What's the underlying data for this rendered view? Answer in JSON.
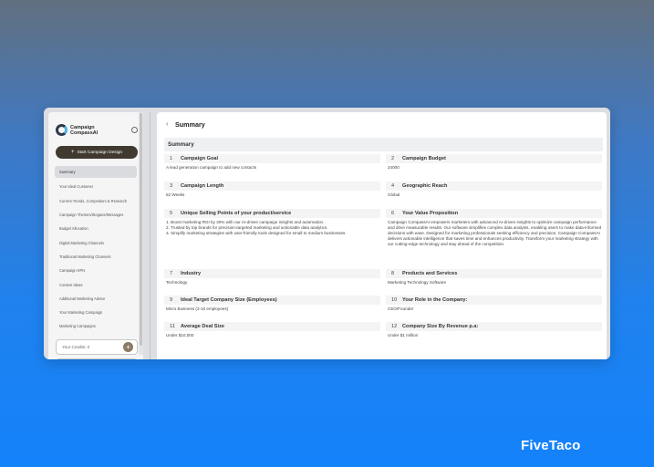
{
  "app": {
    "logo_line1": "Campaign",
    "logo_line2": "CompassAI",
    "start_button": "Start Campaign Design",
    "start_plus": "+",
    "credits_label": "Your Credits: 0",
    "credits_plus": "+"
  },
  "sidebar": {
    "items": [
      "Summary",
      "Your Ideal Customer",
      "Current Trends, Competitors & Research",
      "Campaign Themes/Slogans/Messages",
      "Budget Allocation",
      "Digital Marketing Channels",
      "Traditional Marketing Channels",
      "Campaign KPIs",
      "Content Ideas",
      "Additional Marketing Advice",
      "Your Marketing Campaign",
      "Marketing Campaigns"
    ]
  },
  "main": {
    "back_icon": "‹",
    "page_title": "Summary",
    "section_title": "Summary",
    "cards": [
      {
        "num": "1",
        "title": "Campaign Goal",
        "body": "A lead generation campaign to add new contacts"
      },
      {
        "num": "2",
        "title": "Campaign Budget",
        "body": "24000"
      },
      {
        "num": "3",
        "title": "Campaign Length",
        "body": "52 Weeks"
      },
      {
        "num": "4",
        "title": "Geographic Reach",
        "body": "Global"
      },
      {
        "num": "5",
        "title": "Unique Selling Points of your product/service",
        "body": "1. Boost marketing ROI by 30% with our AI-driven campaign insights and automation.\n2. Trusted by top brands for precision-targeted marketing and actionable data analytics.\n3. Simplify marketing strategies with user-friendly tools designed for small to medium businesses."
      },
      {
        "num": "6",
        "title": "Your Value Proposition",
        "body": "Campaign CompassAI empowers marketers with advanced AI-driven insights to optimize campaign performance and drive measurable results. Our software simplifies complex data analysis, enabling users to make data-informed decisions with ease. Designed for marketing professionals seeking efficiency and precision, Campaign CompassAI delivers actionable intelligence that saves time and enhances productivity. Transform your marketing strategy with our cutting-edge technology and stay ahead of the competition."
      },
      {
        "num": "7",
        "title": "Industry",
        "body": "Technology"
      },
      {
        "num": "8",
        "title": "Products and Services",
        "body": "Marketing Technology Software"
      },
      {
        "num": "9",
        "title": "Ideal Target Company Size  (Employees)",
        "body": "Micro Business (2-10 employees)"
      },
      {
        "num": "10",
        "title": "Your Role in the Company:",
        "body": "CEO/Founder"
      },
      {
        "num": "11",
        "title": "Average Deal Size",
        "body": "Under $10,000"
      },
      {
        "num": "12",
        "title": "Company Size By Revenue p.a:",
        "body": "Under $1 million"
      }
    ]
  },
  "brand": "FiveTaco"
}
